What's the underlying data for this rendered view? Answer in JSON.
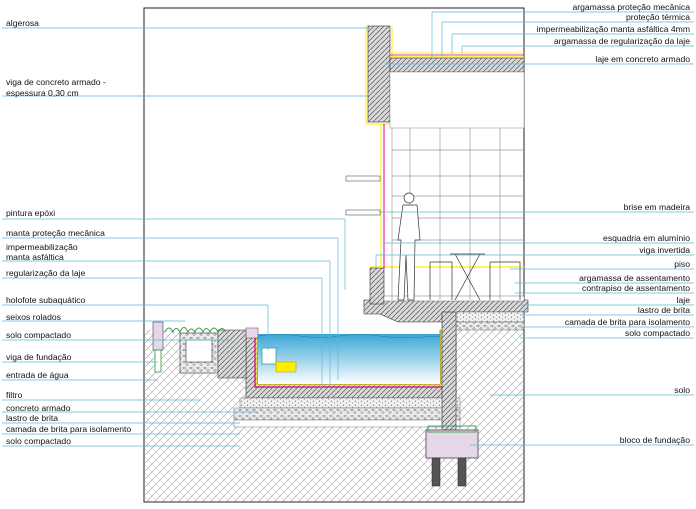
{
  "labels_left": [
    {
      "id": "algerosa",
      "text": "algerosa"
    },
    {
      "id": "viga-concreto-1",
      "text": "viga de concreto armado -"
    },
    {
      "id": "viga-concreto-2",
      "text": "espessura 0,30 cm"
    },
    {
      "id": "pintura-epoxi",
      "text": "pintura epóxi"
    },
    {
      "id": "manta-protecao",
      "text": "manta proteção mecânica"
    },
    {
      "id": "impermeabilizacao-1",
      "text": "impermeabilização"
    },
    {
      "id": "impermeabilizacao-2",
      "text": "manta asfáltica"
    },
    {
      "id": "regularizacao-laje",
      "text": "regularização da laje"
    },
    {
      "id": "holofote",
      "text": "holofote subaquático"
    },
    {
      "id": "seixos",
      "text": "seixos rolados"
    },
    {
      "id": "solo-compactado-1",
      "text": "solo compactado"
    },
    {
      "id": "viga-fundacao",
      "text": "viga de fundação"
    },
    {
      "id": "entrada-agua",
      "text": "entrada de água"
    },
    {
      "id": "filtro",
      "text": "filtro"
    },
    {
      "id": "concreto-armado",
      "text": "concreto armado"
    },
    {
      "id": "lastro-brita-1",
      "text": "lastro de brita"
    },
    {
      "id": "camada-brita-1",
      "text": "camada de brita para isolamento"
    },
    {
      "id": "solo-compactado-2",
      "text": "solo compactado"
    }
  ],
  "labels_right": [
    {
      "id": "argamassa-protecao",
      "text": "argamassa proteção mecânica"
    },
    {
      "id": "protecao-termica",
      "text": "proteção térmica"
    },
    {
      "id": "impermeabilizacao-manta",
      "text": "impermeabilização manta asfáltica 4mm"
    },
    {
      "id": "argamassa-regularizacao",
      "text": "argamassa de regularização da laje"
    },
    {
      "id": "laje-concreto",
      "text": "laje em concreto armado"
    },
    {
      "id": "brise",
      "text": "brise em madeira"
    },
    {
      "id": "esquadria",
      "text": "esquadria em alumínio"
    },
    {
      "id": "viga-invertida",
      "text": "viga invertida"
    },
    {
      "id": "piso",
      "text": "piso"
    },
    {
      "id": "argamassa-assentamento",
      "text": "argamassa de assentamento"
    },
    {
      "id": "contrapiso",
      "text": "contrapiso de assentamento"
    },
    {
      "id": "laje",
      "text": "laje"
    },
    {
      "id": "lastro-brita-2",
      "text": "lastro de brita"
    },
    {
      "id": "camada-brita-2",
      "text": "camada de brita para isolamento"
    },
    {
      "id": "solo-compactado-3",
      "text": "solo compactado"
    },
    {
      "id": "solo",
      "text": "solo"
    },
    {
      "id": "bloco-fundacao",
      "text": "bloco de fundação"
    }
  ],
  "colors": {
    "leader": "#5bb8d8",
    "soil_hatch": "#8a8a8a",
    "concrete": "#6e6e6e",
    "waterproofing": "#ffee00",
    "membrane": "#e0007a",
    "water_top": "#3aa6d6",
    "water_bottom": "#ffffff",
    "glazing": "#9a9a9a"
  }
}
